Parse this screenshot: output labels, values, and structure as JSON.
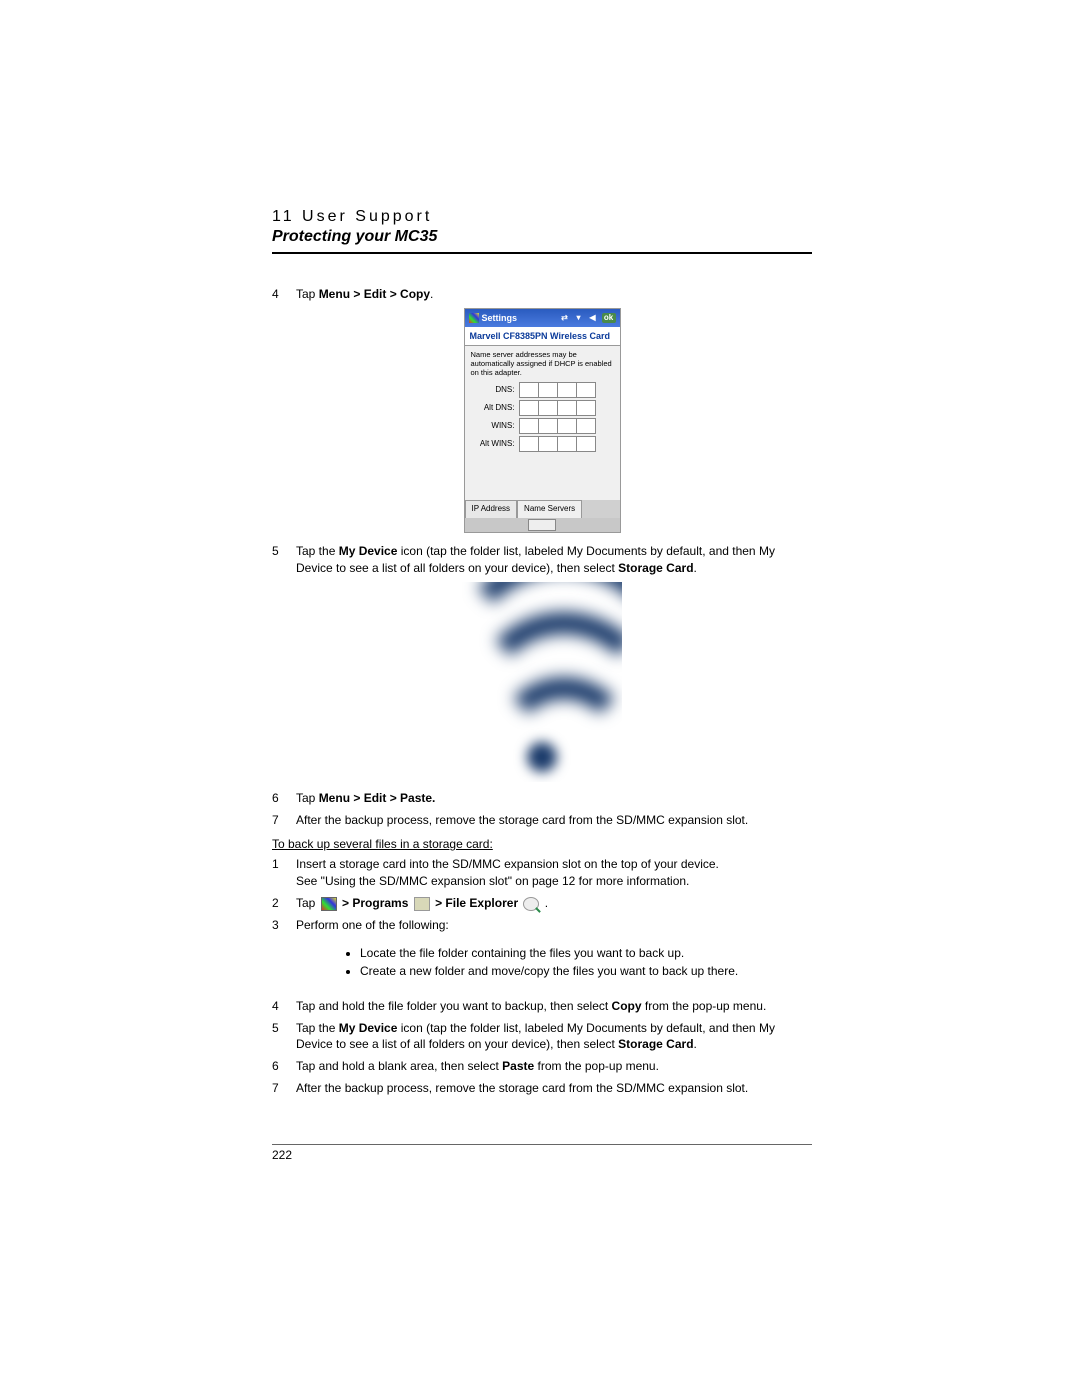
{
  "chapter": "11 User Support",
  "title": "Protecting your MC35",
  "step4": {
    "num": "4",
    "pre": "Tap ",
    "bold": "Menu > Edit > Copy",
    "post": "."
  },
  "screenshot": {
    "window_title": "Settings",
    "ok": "ok",
    "card": "Marvell CF8385PN Wireless Card",
    "note": "Name server addresses may be automatically assigned if DHCP is enabled on this adapter.",
    "dns": "DNS:",
    "altdns": "Alt DNS:",
    "wins": "WINS:",
    "altwins": "Alt WINS:",
    "tab1": "IP Address",
    "tab2": "Name Servers"
  },
  "step5": {
    "num": "5",
    "text_a": "Tap the ",
    "bold_a": "My Device",
    "text_b": " icon (tap the folder list, labeled My Documents by default, and then My Device to see a list of all folders on your device), then select ",
    "bold_b": "Storage Card",
    "text_c": "."
  },
  "step6": {
    "num": "6",
    "pre": "Tap ",
    "bold": "Menu > Edit > Paste."
  },
  "step7": {
    "num": "7",
    "text": "After the backup process, remove the storage card from the SD/MMC expansion slot."
  },
  "subheading": "To back up several files in a storage card:",
  "b1": {
    "num": "1",
    "text_a": "Insert a storage card into the SD/MMC expansion slot on the top of your device.",
    "text_b": "See \"Using the SD/MMC expansion slot\" on page 12 for more information."
  },
  "b2": {
    "num": "2",
    "pre": "Tap ",
    "bold_a": " > Programs ",
    "bold_b": " > File Explorer ",
    "post": "."
  },
  "b3": {
    "num": "3",
    "text": "Perform one of the following:",
    "li1": "Locate the file folder containing the files you want to back up.",
    "li2": "Create a new folder and move/copy the files you want to back up there."
  },
  "b4": {
    "num": "4",
    "text_a": "Tap and hold the file folder you want to backup, then select ",
    "bold": "Copy",
    "text_b": " from the pop-up menu."
  },
  "b5": {
    "num": "5",
    "text_a": "Tap the ",
    "bold_a": "My Device",
    "text_b": " icon (tap the folder list, labeled My Documents by default, and then My Device to see a list of all folders on your device), then select ",
    "bold_b": "Storage Card",
    "text_c": "."
  },
  "b6": {
    "num": "6",
    "text_a": "Tap and hold a blank area, then select ",
    "bold": "Paste",
    "text_b": " from the pop-up menu."
  },
  "b7": {
    "num": "7",
    "text": "After the backup process, remove the storage card from the SD/MMC expansion slot."
  },
  "page_number": "222"
}
